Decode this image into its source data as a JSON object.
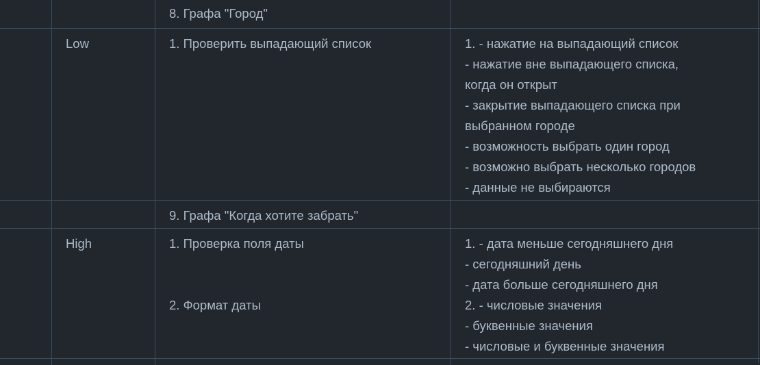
{
  "table": {
    "rows": [
      {
        "priority": "",
        "check": [
          "8. Графа \"Город\""
        ],
        "cases": []
      },
      {
        "priority": "Low",
        "check": [
          "1. Проверить выпадающий список"
        ],
        "cases": [
          "1. - нажатие на выпадающий список",
          "- нажатие вне выпадающего списка,",
          "когда он открыт",
          "- закрытие выпадающего списка при",
          "выбранном городе",
          "- возможность выбрать один город",
          "- возможно выбрать несколько городов",
          "- данные не выбираются"
        ]
      },
      {
        "priority": "",
        "check": [
          "9. Графа \"Когда хотите забрать\""
        ],
        "cases": []
      },
      {
        "priority": "High",
        "check": [
          "1. Проверка поля даты",
          "2. Формат даты"
        ],
        "cases": [
          "1. - дата меньше сегодняшнего дня",
          "- сегодняшний день",
          "- дата больше сегодняшнего дня",
          "2. - числовые значения",
          "- буквенные значения",
          "- числовые и буквенные значения"
        ]
      }
    ]
  }
}
